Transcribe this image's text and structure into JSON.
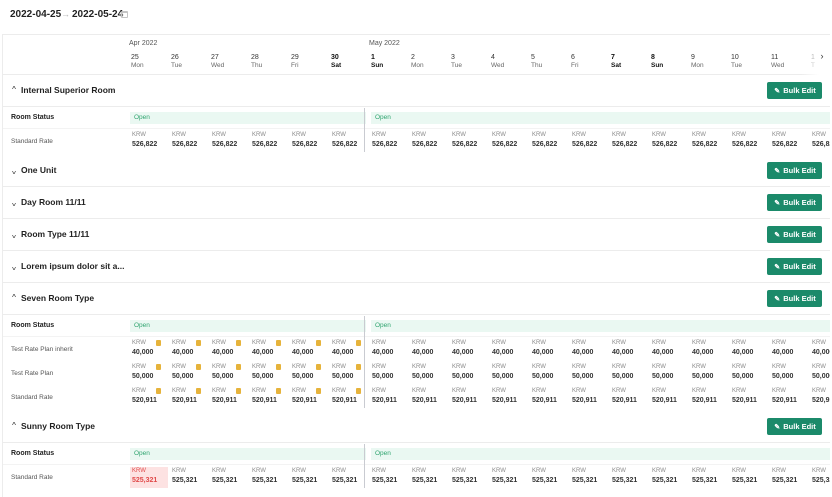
{
  "toolbar": {
    "start_date": "2022-04-25",
    "arrow_icon": "arrow-right-icon",
    "end_date": "2022-05-24",
    "calendar_icon": "calendar-icon"
  },
  "calendar": {
    "months": [
      {
        "label": "Apr 2022"
      },
      {
        "label": "May 2022"
      }
    ],
    "days": [
      {
        "num": "25",
        "dow": "Mon",
        "weekend": false
      },
      {
        "num": "26",
        "dow": "Tue",
        "weekend": false
      },
      {
        "num": "27",
        "dow": "Wed",
        "weekend": false
      },
      {
        "num": "28",
        "dow": "Thu",
        "weekend": false
      },
      {
        "num": "29",
        "dow": "Fri",
        "weekend": false
      },
      {
        "num": "30",
        "dow": "Sat",
        "weekend": true
      },
      {
        "num": "1",
        "dow": "Sun",
        "weekend": true
      },
      {
        "num": "2",
        "dow": "Mon",
        "weekend": false
      },
      {
        "num": "3",
        "dow": "Tue",
        "weekend": false
      },
      {
        "num": "4",
        "dow": "Wed",
        "weekend": false
      },
      {
        "num": "5",
        "dow": "Thu",
        "weekend": false
      },
      {
        "num": "6",
        "dow": "Fri",
        "weekend": false
      },
      {
        "num": "7",
        "dow": "Sat",
        "weekend": true
      },
      {
        "num": "8",
        "dow": "Sun",
        "weekend": true
      },
      {
        "num": "9",
        "dow": "Mon",
        "weekend": false
      },
      {
        "num": "10",
        "dow": "Tue",
        "weekend": false
      },
      {
        "num": "11",
        "dow": "Wed",
        "weekend": false
      },
      {
        "num": "1",
        "dow": "T",
        "weekend": false
      }
    ],
    "next_icon": "chevron-right-icon"
  },
  "labels": {
    "bulk_edit": "Bulk Edit",
    "room_status": "Room Status",
    "open": "Open",
    "currency": "KRW"
  },
  "rooms": [
    {
      "name": "Internal Superior Room",
      "expanded": true,
      "rates": [
        {
          "label": "Standard Rate",
          "value": "526,822",
          "has_doc": false,
          "alert_first": false
        }
      ]
    },
    {
      "name": "One Unit",
      "expanded": false,
      "rates": []
    },
    {
      "name": "Day Room 11/11",
      "expanded": false,
      "rates": []
    },
    {
      "name": "Room Type 11/11",
      "expanded": false,
      "rates": []
    },
    {
      "name": "Lorem ipsum dolor sit a...",
      "expanded": false,
      "rates": []
    },
    {
      "name": "Seven Room Type",
      "expanded": true,
      "rates": [
        {
          "label": "Test Rate Plan inherit",
          "value": "40,000",
          "has_doc": true,
          "alert_first": false
        },
        {
          "label": "Test Rate Plan",
          "value": "50,000",
          "has_doc": true,
          "alert_first": false
        },
        {
          "label": "Standard Rate",
          "value": "520,911",
          "has_doc": true,
          "alert_first": false
        }
      ]
    },
    {
      "name": "Sunny Room Type",
      "expanded": true,
      "rates": [
        {
          "label": "Standard Rate",
          "value": "525,321",
          "has_doc": false,
          "alert_first": true
        }
      ]
    }
  ],
  "colors": {
    "primary_button": "#1b8a6a",
    "open_bg": "#eaf8f2",
    "open_text": "#2fa46f",
    "alert_bg": "#fde2e2",
    "alert_text": "#e04a4a",
    "doc_icon": "#e6b33b"
  }
}
